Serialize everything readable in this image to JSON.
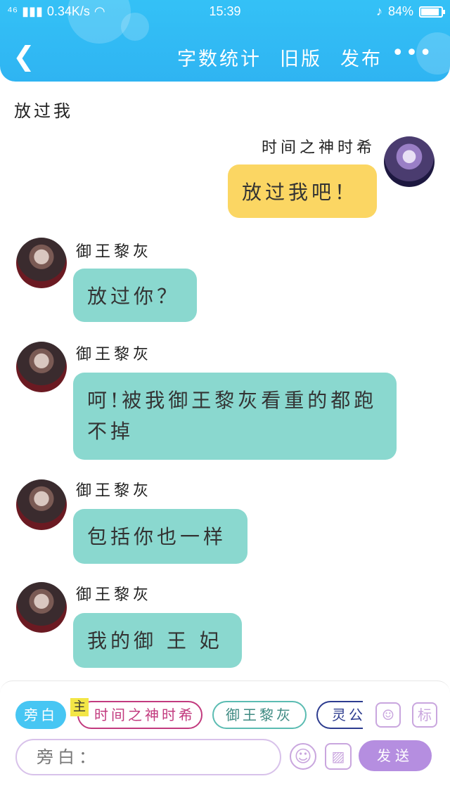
{
  "status_bar": {
    "network": "⁴⁶",
    "speed": "0.34K/s",
    "time": "15:39",
    "battery": "84%",
    "battery_level": 0.84
  },
  "header": {
    "back_icon": "back-chevron-icon",
    "actions": [
      "字数统计",
      "旧版",
      "发布"
    ],
    "more": "•••"
  },
  "chat": {
    "narration": "放过我",
    "messages": [
      {
        "speaker": "时间之神时希",
        "side": "right",
        "text": "放过我吧！"
      },
      {
        "speaker": "御王黎灰",
        "side": "left",
        "text": "放过你？"
      },
      {
        "speaker": "御王黎灰",
        "side": "left",
        "text": "呵!被我御王黎灰看重的都跑不掉"
      },
      {
        "speaker": "御王黎灰",
        "side": "left",
        "text": "包括你也一样"
      },
      {
        "speaker": "御王黎灰",
        "side": "left",
        "text": "我的御 王 妃"
      }
    ]
  },
  "composer": {
    "roles": {
      "narration": "旁白",
      "protagonist_tag": "主",
      "protagonist": "时间之神时希",
      "role2": "御王黎灰",
      "role3": "灵公"
    },
    "mark_label": "标",
    "input_placeholder": "旁白：",
    "send_label": "发送"
  },
  "colors": {
    "header": "#34c1f6",
    "bubble_other": "#8ad8cf",
    "bubble_self": "#fbd663",
    "send": "#b58ee0"
  }
}
